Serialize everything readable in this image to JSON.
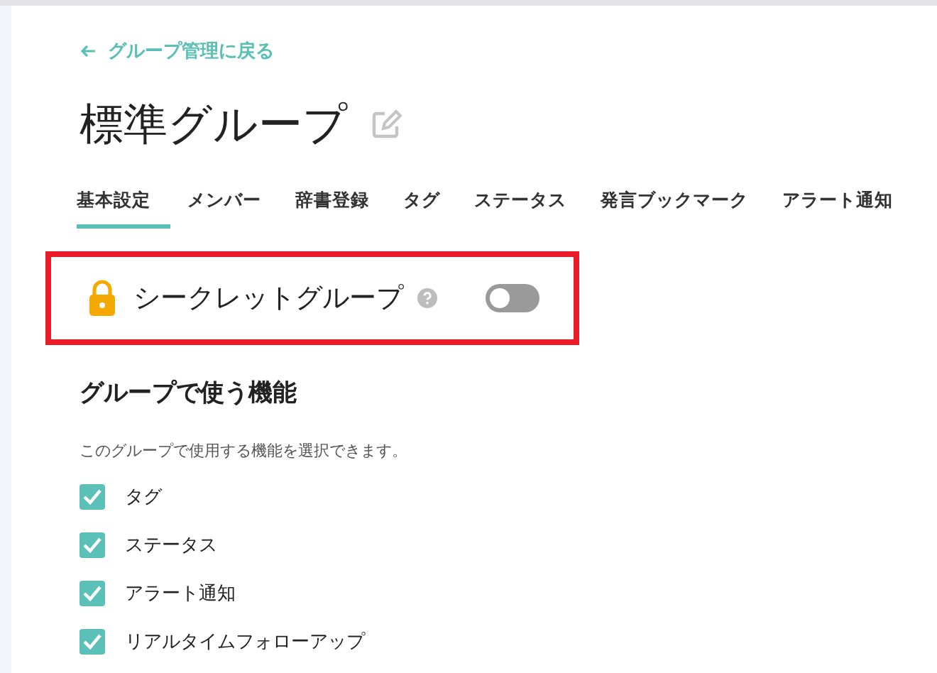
{
  "back_link": "グループ管理に戻る",
  "title": "標準グループ",
  "tabs": [
    {
      "label": "基本設定",
      "selected": true
    },
    {
      "label": "メンバー",
      "selected": false
    },
    {
      "label": "辞書登録",
      "selected": false
    },
    {
      "label": "タグ",
      "selected": false
    },
    {
      "label": "ステータス",
      "selected": false
    },
    {
      "label": "発言ブックマーク",
      "selected": false
    },
    {
      "label": "アラート通知",
      "selected": false
    }
  ],
  "secret": {
    "label": "シークレットグループ",
    "on": false,
    "highlighted": true
  },
  "features": {
    "heading": "グループで使う機能",
    "description": "このグループで使用する機能を選択できます。",
    "items": [
      {
        "label": "タグ",
        "checked": true
      },
      {
        "label": "ステータス",
        "checked": true
      },
      {
        "label": "アラート通知",
        "checked": true
      },
      {
        "label": "リアルタイムフォローアップ",
        "checked": true
      }
    ]
  }
}
